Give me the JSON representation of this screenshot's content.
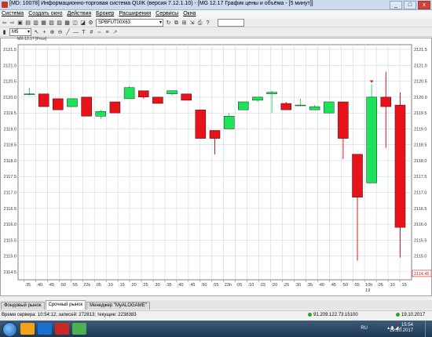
{
  "window": {
    "title": "[MD: 10078] Информационно-торговая система QUIK (версия 7.12.1.10) - [MG 12.17 График цены и объёма - [5 минут]]",
    "buttons": [
      "_",
      "□",
      "x"
    ]
  },
  "menu": [
    "Система",
    "Создать окно",
    "Действия",
    "Брокер",
    "Расширения",
    "Сервисы",
    "Окна"
  ],
  "toolbar": {
    "instrument": "SPBFUT00X63",
    "timeframe": "M5"
  },
  "chart": {
    "label": "MX-12.17 [Price]"
  },
  "chart_data": {
    "type": "candlestick",
    "y_ticks": [
      "2121.5",
      "2121.0",
      "2120.5",
      "2120.0",
      "2119.5",
      "2119.0",
      "2118.5",
      "2118.0",
      "2117.5",
      "2117.0",
      "2116.5",
      "2116.0",
      "2115.5",
      "2115.0",
      "2114.5"
    ],
    "ylim": [
      2114.25,
      2121.65
    ],
    "current_price": "2114.45",
    "x_ticks": [
      ":35",
      ":40",
      ":45",
      ":50",
      ":55",
      "22k",
      ":05",
      ":10",
      ":15",
      ":20",
      ":25",
      ":30",
      ":35",
      ":40",
      ":45",
      ":50",
      ":55",
      "23h",
      ":05",
      ":10",
      ":15",
      ":20",
      ":25",
      ":30",
      ":35",
      ":40",
      ":45",
      ":50",
      ":55",
      "10h",
      ":05",
      ":10",
      ":15"
    ],
    "x_tick_sub": {
      "index": 29,
      "label": "19"
    },
    "candles": [
      {
        "o": 2120.1,
        "h": 2120.3,
        "l": 2120.05,
        "c": 2120.1
      },
      {
        "o": 2120.1,
        "h": 2120.1,
        "l": 2119.7,
        "c": 2119.7
      },
      {
        "o": 2119.95,
        "h": 2119.95,
        "l": 2119.6,
        "c": 2119.6
      },
      {
        "o": 2119.7,
        "h": 2119.95,
        "l": 2119.7,
        "c": 2119.95
      },
      {
        "o": 2120.0,
        "h": 2120.0,
        "l": 2119.4,
        "c": 2119.4
      },
      {
        "o": 2119.4,
        "h": 2119.6,
        "l": 2119.3,
        "c": 2119.55
      },
      {
        "o": 2119.85,
        "h": 2119.85,
        "l": 2119.5,
        "c": 2119.5
      },
      {
        "o": 2119.95,
        "h": 2120.35,
        "l": 2119.95,
        "c": 2120.3
      },
      {
        "o": 2120.2,
        "h": 2120.2,
        "l": 2119.95,
        "c": 2120.0
      },
      {
        "o": 2120.0,
        "h": 2120.0,
        "l": 2119.8,
        "c": 2119.8
      },
      {
        "o": 2120.1,
        "h": 2120.2,
        "l": 2120.05,
        "c": 2120.2
      },
      {
        "o": 2120.1,
        "h": 2120.1,
        "l": 2119.9,
        "c": 2119.9
      },
      {
        "o": 2119.6,
        "h": 2119.6,
        "l": 2118.7,
        "c": 2118.7
      },
      {
        "o": 2118.95,
        "h": 2118.95,
        "l": 2118.2,
        "c": 2118.7
      },
      {
        "o": 2119.0,
        "h": 2119.5,
        "l": 2119.0,
        "c": 2119.4
      },
      {
        "o": 2119.6,
        "h": 2119.85,
        "l": 2119.6,
        "c": 2119.85
      },
      {
        "o": 2119.9,
        "h": 2120.0,
        "l": 2119.85,
        "c": 2120.0
      },
      {
        "o": 2120.1,
        "h": 2120.2,
        "l": 2119.5,
        "c": 2120.15
      },
      {
        "o": 2119.8,
        "h": 2119.85,
        "l": 2119.6,
        "c": 2119.6
      },
      {
        "o": 2119.75,
        "h": 2119.95,
        "l": 2119.75,
        "c": 2119.75
      },
      {
        "o": 2119.6,
        "h": 2119.75,
        "l": 2119.6,
        "c": 2119.7
      },
      {
        "o": 2119.5,
        "h": 2119.85,
        "l": 2119.5,
        "c": 2119.85
      },
      {
        "o": 2119.85,
        "h": 2119.85,
        "l": 2118.05,
        "c": 2118.7
      },
      {
        "o": 2118.2,
        "h": 2118.2,
        "l": 2114.85,
        "c": 2116.85
      },
      {
        "o": 2117.3,
        "h": 2120.4,
        "l": 2117.3,
        "c": 2120.0
      },
      {
        "o": 2120.0,
        "h": 2120.8,
        "l": 2118.4,
        "c": 2119.7
      },
      {
        "o": 2119.75,
        "h": 2120.15,
        "l": 2114.95,
        "c": 2115.9
      }
    ],
    "colors": {
      "up": "#1ee35a",
      "down": "#e8121a",
      "grid": "#cfd6e3",
      "axis": "#808080",
      "current": "#e8121a"
    }
  },
  "tabs": [
    "Фондовый рынок",
    "Срочный рынок",
    "Менеджер \"MyALOGAME\""
  ],
  "status": {
    "server": "Время сервера: 10:54:12; записей: 272813; текущие: 2238383",
    "connection": "91.209.122.73:15100",
    "date": "19.10.2017"
  },
  "taskbar": {
    "lang": "RU",
    "time": "15:54",
    "date": "19.10.2017"
  }
}
